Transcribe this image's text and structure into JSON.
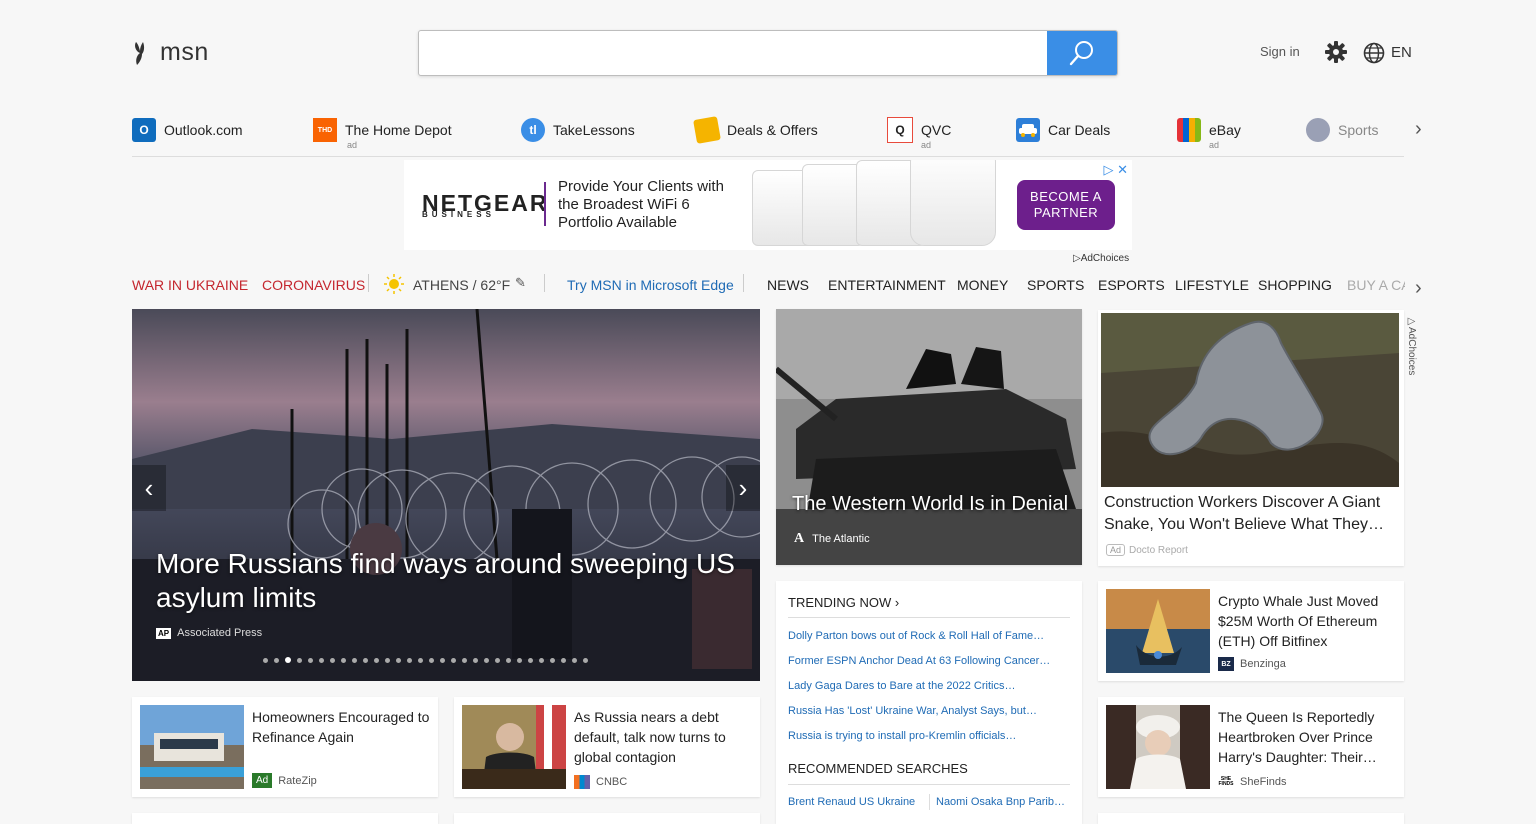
{
  "header": {
    "brand": "msn",
    "search_placeholder": "",
    "sign_in": "Sign in",
    "language": "EN"
  },
  "quicklinks": [
    {
      "label": "Outlook.com",
      "sub": "",
      "icon": "outlook-icon",
      "color": "#0f6cbd"
    },
    {
      "label": "The Home Depot",
      "sub": "ad",
      "icon": "home-depot-icon",
      "color": "#f96302"
    },
    {
      "label": "TakeLessons",
      "sub": "",
      "icon": "takelessons-icon",
      "color": "#3a8ee6"
    },
    {
      "label": "Deals & Offers",
      "sub": "",
      "icon": "deals-tag-icon",
      "color": "#f5b400"
    },
    {
      "label": "QVC",
      "sub": "ad",
      "icon": "qvc-icon",
      "color": "#e84b3c"
    },
    {
      "label": "Car Deals",
      "sub": "",
      "icon": "car-icon",
      "color": "#2d7fd8"
    },
    {
      "label": "eBay",
      "sub": "ad",
      "icon": "ebay-bag-icon",
      "color": "#222222"
    },
    {
      "label": "Sports",
      "sub": "",
      "icon": "sports-ball-icon",
      "color": "#9aa0b5"
    }
  ],
  "ad_banner": {
    "brand": "NETGEAR",
    "brand_sub": "BUSINESS",
    "copy": "Provide Your Clients with the Broadest WiFi 6 Portfolio Available",
    "cta": "BECOME A PARTNER",
    "adchoices": "AdChoices"
  },
  "nav": {
    "highlights": [
      "WAR IN UKRAINE",
      "CORONAVIRUS"
    ],
    "weather": "ATHENS / 62°F",
    "edge_promo": "Try MSN in Microsoft Edge",
    "items": [
      "NEWS",
      "ENTERTAINMENT",
      "MONEY",
      "SPORTS",
      "ESPORTS",
      "LIFESTYLE",
      "SHOPPING",
      "BUY A CA"
    ]
  },
  "hero": {
    "title": "More Russians find ways around sweeping US asylum limits",
    "source_badge": "AP",
    "source": "Associated Press",
    "slide_count": 30,
    "active_slide": 3
  },
  "tank_card": {
    "title": "The Western World Is in Denial",
    "source": "The Atlantic",
    "source_badge": "A"
  },
  "snake_card": {
    "title": "Construction Workers Discover A Giant Snake, You Won't Believe What They…",
    "ad": "Ad",
    "source": "Docto Report",
    "adchoices": "AdChoices"
  },
  "trending": {
    "heading": "TRENDING NOW",
    "items": [
      "Dolly Parton bows out of Rock & Roll Hall of Fame…",
      "Former ESPN Anchor Dead At 63 Following Cancer…",
      "Lady Gaga Dares to Bare at the 2022 Critics…",
      "Russia Has 'Lost' Ukraine War, Analyst Says, but…",
      "Russia is trying to install pro-Kremlin officials…"
    ],
    "rec_heading": "RECOMMENDED SEARCHES",
    "rec_items": [
      "Brent Renaud US Ukraine",
      "Naomi Osaka Bnp Parib…"
    ]
  },
  "cards": [
    {
      "title": "Homeowners Encouraged to Refinance Again",
      "source": "RateZip",
      "ad": "Ad"
    },
    {
      "title": "As Russia nears a debt default, talk now turns to global contagion",
      "source": "CNBC"
    },
    {
      "title": "Crypto Whale Just Moved $25M Worth Of Ethereum (ETH) Off Bitfinex",
      "source": "Benzinga",
      "badge": "BZ"
    },
    {
      "title": "The Queen Is Reportedly Heartbroken Over Prince Harry's Daughter: Their…",
      "source": "SheFinds",
      "badge": "SHE FINDS"
    }
  ]
}
